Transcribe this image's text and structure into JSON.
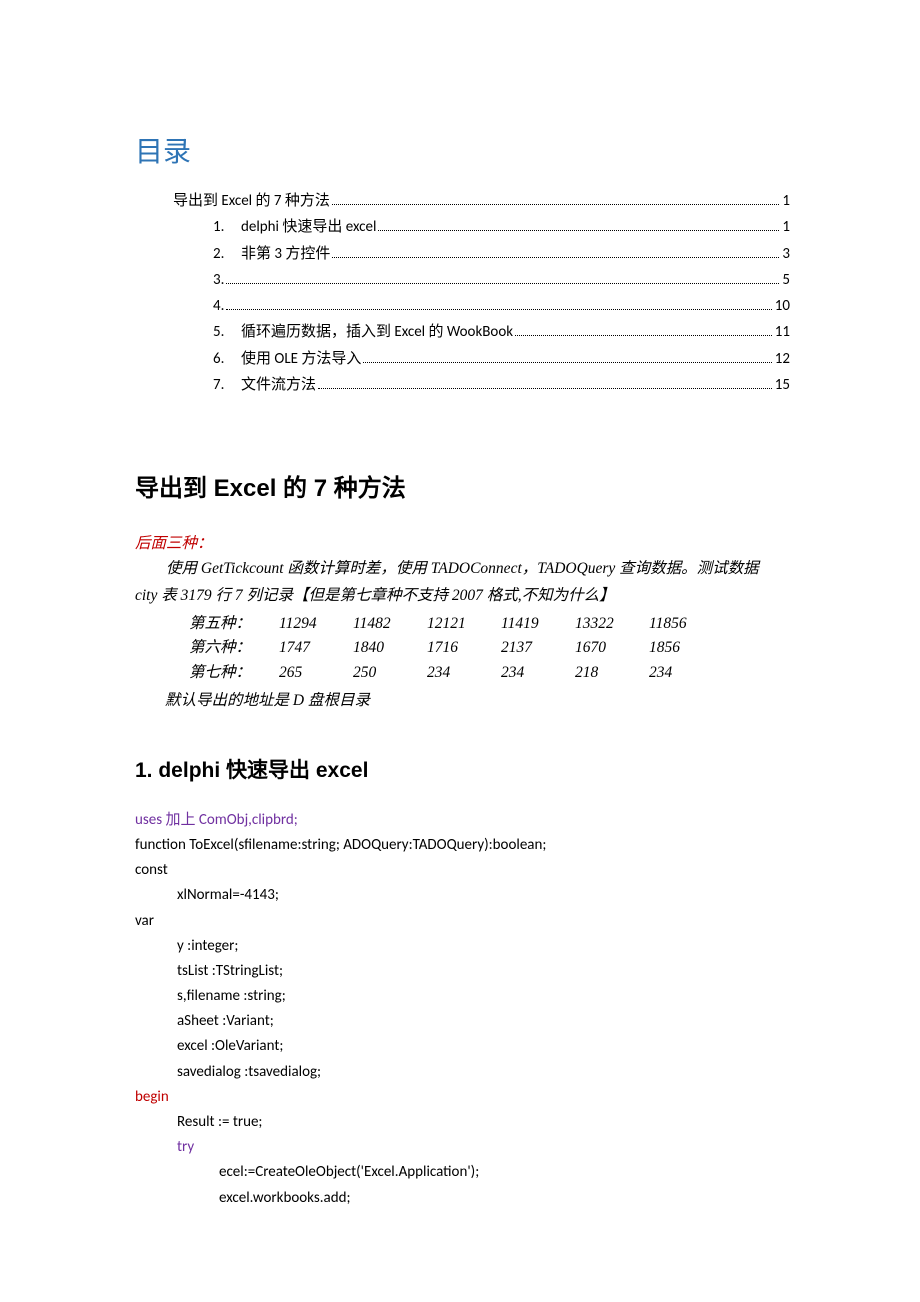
{
  "toc": {
    "title": "目录",
    "items": [
      {
        "label": "导出到 Excel 的 7 种方法",
        "page": "1",
        "sub": false,
        "prefix": ""
      },
      {
        "label": "delphi  快速导出 excel",
        "page": "1",
        "sub": true,
        "prefix": "1."
      },
      {
        "label": "非第 3 方控件",
        "page": "3",
        "sub": true,
        "prefix": "2."
      },
      {
        "label": "",
        "page": "5",
        "sub": true,
        "prefix": "3."
      },
      {
        "label": "",
        "page": "10",
        "sub": true,
        "prefix": "4."
      },
      {
        "label": "循环遍历数据，插入到 Excel 的 WookBook",
        "page": "11",
        "sub": true,
        "prefix": "5."
      },
      {
        "label": "使用 OLE 方法导入",
        "page": "12",
        "sub": true,
        "prefix": "6."
      },
      {
        "label": "文件流方法",
        "page": "15",
        "sub": true,
        "prefix": "7."
      }
    ]
  },
  "heading1": "导出到 Excel 的 7 种方法",
  "red_head": "后面三种：",
  "intro_p1": "使用 GetTickcount 函数计算时差，使用 TADOConnect，TADOQuery 查询数据。测试数据",
  "intro_p2": "city 表 3179 行 7 列记录【但是第七章种不支持 2007 格式,不知为什么】",
  "timings": [
    {
      "label": "第五种：",
      "cells": [
        "11294",
        "11482",
        "12121",
        "11419",
        "13322",
        "11856"
      ]
    },
    {
      "label": "第六种：",
      "cells": [
        "1747",
        "1840",
        "1716",
        "2137",
        "1670",
        "1856"
      ]
    },
    {
      "label": "第七种：",
      "cells": [
        "265",
        "250",
        "234",
        "234",
        "218",
        "234"
      ]
    }
  ],
  "intro_foot": "默认导出的地址是 D 盘根目录",
  "heading2": "1.  delphi  快速导出 excel",
  "code": {
    "l1a": "uses 加上  ComObj,clipbrd;",
    "l2": "function ToExcel(sfilename:string; ADOQuery:TADOQuery):boolean;",
    "l3": "const",
    "l4": "xlNormal=-4143;",
    "l5": "var",
    "l6": "y :integer;",
    "l7": "tsList :TStringList;",
    "l8": "s,filename :string;",
    "l9": "aSheet :Variant;",
    "l10": "excel :OleVariant;",
    "l11": "savedialog :tsavedialog;",
    "l12": "begin",
    "l13": "Result := true;",
    "l14": "try",
    "l15": "ecel:=CreateOleObject('Excel.Application');",
    "l16": "excel.workbooks.add;"
  }
}
